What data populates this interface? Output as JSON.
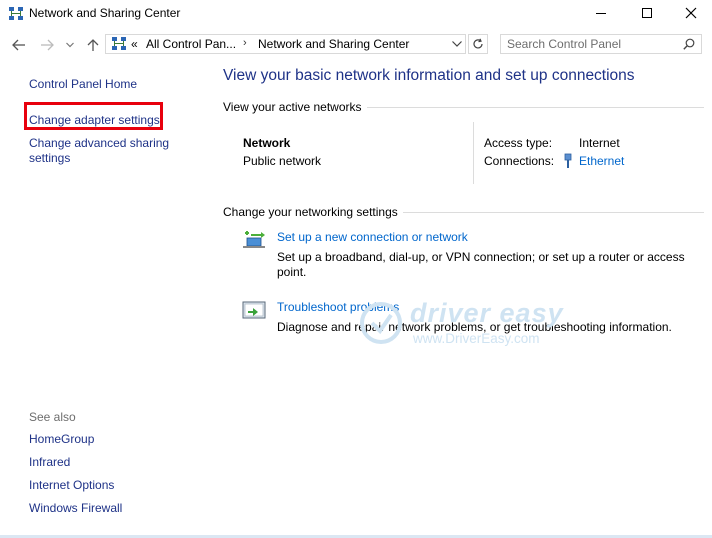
{
  "window": {
    "title": "Network and Sharing Center"
  },
  "address_bar": {
    "overflow": "«",
    "crumbs": [
      "All Control Pan...",
      "Network and Sharing Center"
    ],
    "separator": "›"
  },
  "search": {
    "placeholder": "Search Control Panel"
  },
  "sidebar": {
    "home": "Control Panel Home",
    "items": [
      {
        "label": "Change adapter settings",
        "highlighted": true
      },
      {
        "label_line1": "Change advanced sharing",
        "label_line2": "settings"
      }
    ],
    "see_also": {
      "heading": "See also",
      "links": [
        "HomeGroup",
        "Infrared",
        "Internet Options",
        "Windows Firewall"
      ]
    }
  },
  "main": {
    "heading": "View your basic network information and set up connections",
    "active_networks_label": "View your active networks",
    "network": {
      "name": "Network",
      "type": "Public network",
      "access_type_label": "Access type:",
      "access_type_value": "Internet",
      "connections_label": "Connections:",
      "connections_value": "Ethernet"
    },
    "change_settings_label": "Change your networking settings",
    "tasks": [
      {
        "icon": "new-connection-icon",
        "link": "Set up a new connection or network",
        "desc_line1": "Set up a broadband, dial-up, or VPN connection; or set up a router or access",
        "desc_line2": "point."
      },
      {
        "icon": "troubleshoot-icon",
        "link": "Troubleshoot problems",
        "desc_line1": "Diagnose and repair network problems, or get troubleshooting information."
      }
    ]
  },
  "watermark": {
    "text": "driver easy",
    "url": "www.DriverEasy.com"
  },
  "colors": {
    "link_dark": "#1e3287",
    "link": "#0066cc",
    "highlight": "#e8000d",
    "muted": "#6d6d6d"
  }
}
